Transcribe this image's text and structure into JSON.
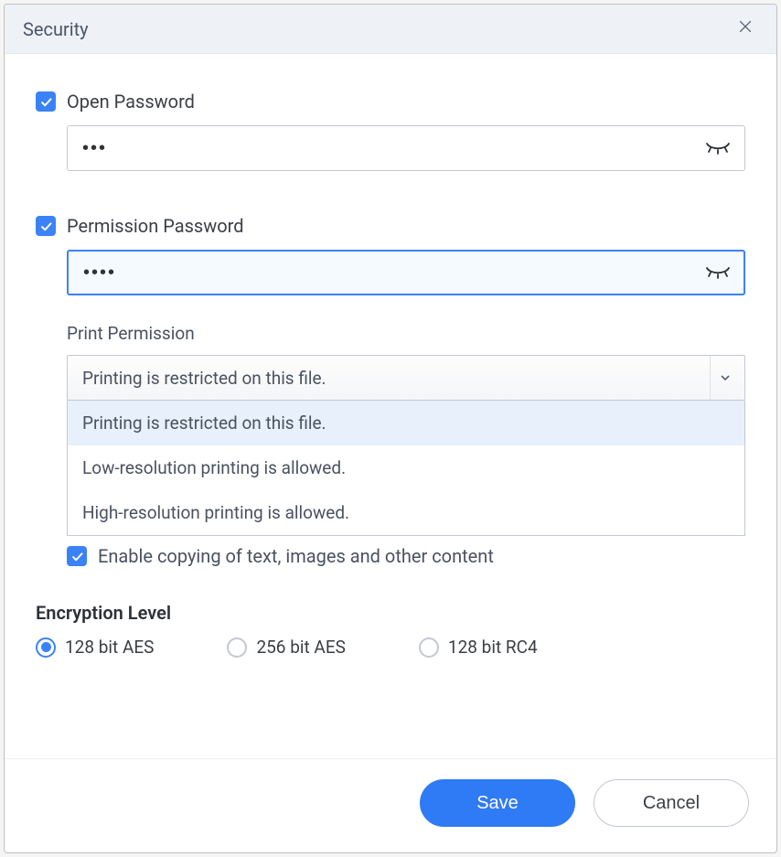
{
  "dialog": {
    "title": "Security"
  },
  "open_password": {
    "label": "Open Password",
    "checked": true,
    "value": "•••"
  },
  "permission_password": {
    "label": "Permission Password",
    "checked": true,
    "value": "••••"
  },
  "print_permission": {
    "label": "Print Permission",
    "selected": "Printing is restricted on this file.",
    "options": [
      "Printing is restricted on this file.",
      "Low-resolution printing is allowed.",
      "High-resolution printing is allowed."
    ]
  },
  "enable_copy": {
    "checked": true,
    "label": "Enable copying of text, images and other content"
  },
  "encryption": {
    "title": "Encryption Level",
    "options": [
      {
        "label": "128 bit AES",
        "checked": true
      },
      {
        "label": "256 bit AES",
        "checked": false
      },
      {
        "label": "128 bit RC4",
        "checked": false
      }
    ]
  },
  "footer": {
    "save": "Save",
    "cancel": "Cancel"
  }
}
